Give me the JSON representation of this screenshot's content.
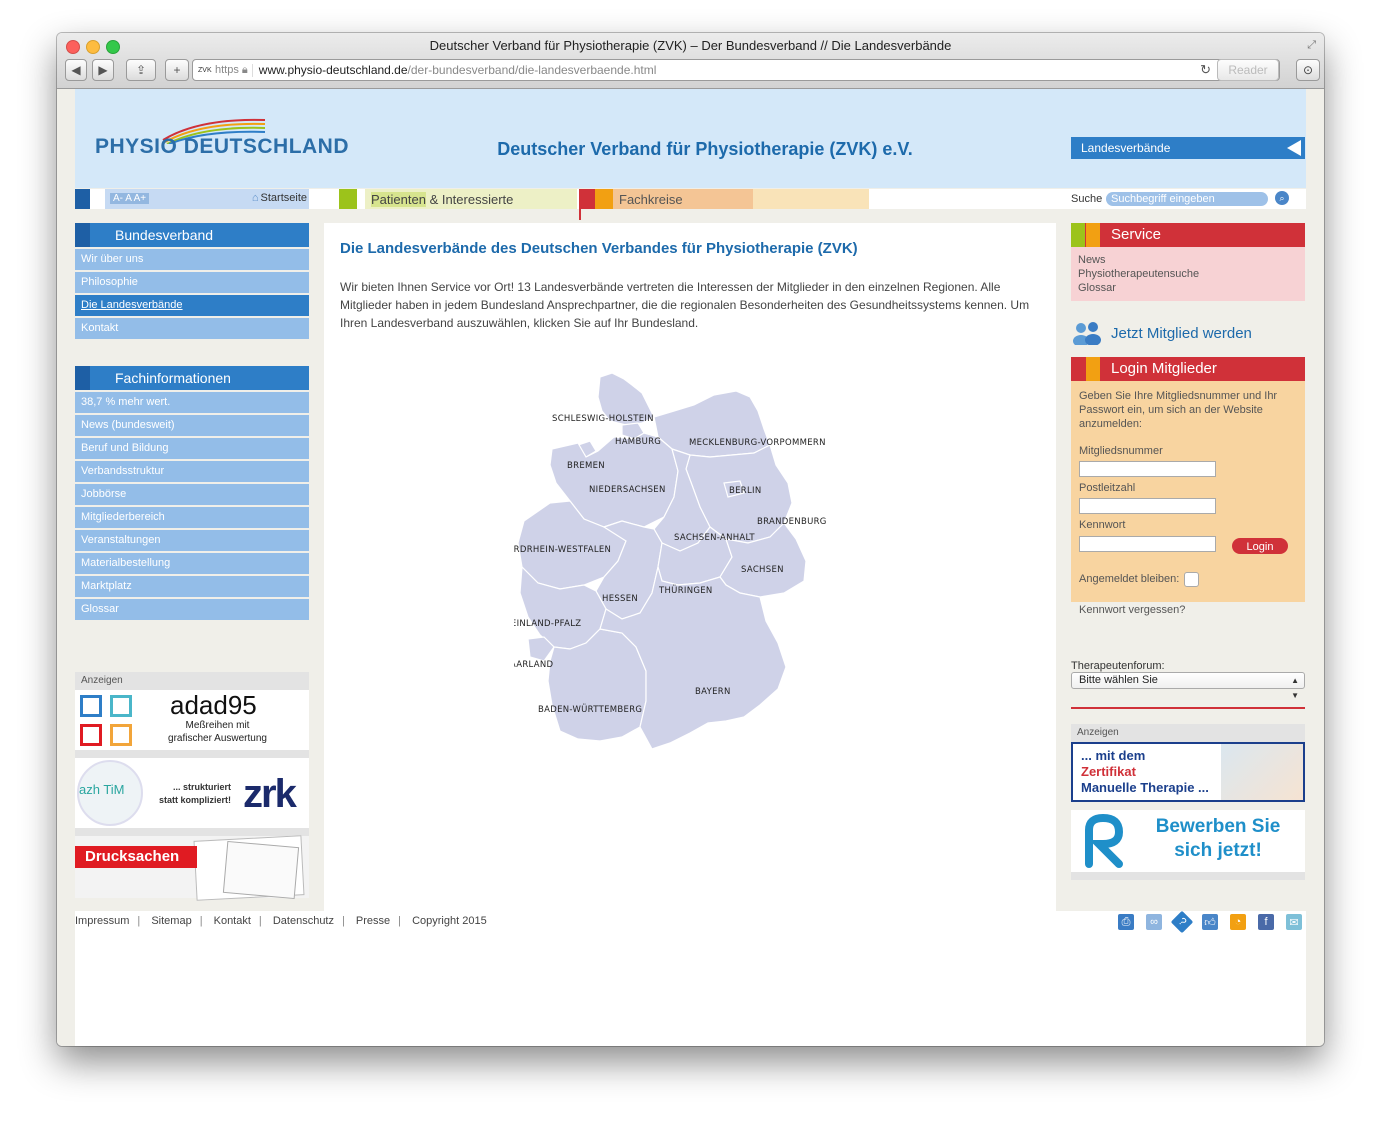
{
  "browser": {
    "title": "Deutscher Verband für Physiotherapie (ZVK) – Der Bundesverband // Die Landesverbände",
    "url_favicon": "ZVK",
    "url_scheme": "https",
    "url_host": "www.physio-deutschland.de",
    "url_path": "/der-bundesverband/die-landesverbaende.html",
    "reader_label": "Reader"
  },
  "header": {
    "logo_text": "PHYSIO DEUTSCHLAND",
    "site_title": "Deutscher Verband für Physiotherapie (ZVK) e.V.",
    "landesverbaende_label": "Landesverbände"
  },
  "topnav": {
    "font_sizes": "A- A A+",
    "home_label": "Startseite",
    "patienten_label": "Patienten",
    "patienten_rest": "& Interessierte",
    "fachkreise_label": "Fachkreise",
    "search_label": "Suche",
    "search_placeholder": "Suchbegriff eingeben"
  },
  "sidebar": {
    "bundesverband": {
      "title": "Bundesverband",
      "items": [
        "Wir über uns",
        "Philosophie",
        "Die Landesverbände",
        "Kontakt"
      ]
    },
    "fachinfo": {
      "title": "Fachinformationen",
      "items": [
        "38,7 % mehr wert.",
        "News (bundesweit)",
        "Beruf und Bildung",
        "Verbandsstruktur",
        "Jobbörse",
        "Mitgliederbereich",
        "Veranstaltungen",
        "Materialbestellung",
        "Marktplatz",
        "Glossar"
      ]
    },
    "ads": {
      "label": "Anzeigen",
      "adad_title": "adad95",
      "adad_sub1": "Meßreihen mit",
      "adad_sub2": "grafischer Auswertung",
      "azh_logo": "azh TiM",
      "azh_text1": "... strukturiert",
      "azh_text2": "statt kompliziert!",
      "zrk": "zrk",
      "drucksachen": "Drucksachen"
    }
  },
  "main": {
    "heading": "Die Landesverbände des Deutschen Verbandes für Physiotherapie (ZVK)",
    "intro": "Wir bieten Ihnen Service vor Ort! 13 Landesverbände vertreten die Interessen der Mitglieder in den einzelnen Regionen. Alle Mitglieder haben in jedem Bundesland Ansprechpartner, die die regionalen Besonderheiten des Gesundheitssystems kennen. Um Ihren Landesverband auszuwählen, klicken Sie auf Ihr Bundesland.",
    "map_states": [
      "SCHLESWIG-HOLSTEIN",
      "HAMBURG",
      "MECKLENBURG-VORPOMMERN",
      "BREMEN",
      "NIEDERSACHSEN",
      "BERLIN",
      "BRANDENBURG",
      "SACHSEN-ANHALT",
      "NORDRHEIN-WESTFALEN",
      "SACHSEN",
      "HESSEN",
      "THÜRINGEN",
      "RHEINLAND-PFALZ",
      "SAARLAND",
      "BAYERN",
      "BADEN-WÜRTTEMBERG"
    ],
    "map_color": "#cfd2e8"
  },
  "right": {
    "service": {
      "title": "Service",
      "items": [
        "News",
        "Physiotherapeutensuche",
        "Glossar"
      ]
    },
    "join_label": "Jetzt Mitglied werden",
    "login": {
      "title": "Login Mitglieder",
      "intro": "Geben Sie Ihre Mitgliedsnummer und Ihr Passwort ein, um sich an der Website anzumelden:",
      "field1": "Mitgliedsnummer",
      "field2": "Postleitzahl",
      "field3": "Kennwort",
      "button": "Login",
      "remember": "Angemeldet bleiben:",
      "forgot": "Kennwort vergessen?"
    },
    "forum_label": "Therapeutenforum:",
    "forum_select": "Bitte wählen Sie",
    "ads": {
      "label": "Anzeigen",
      "mt_line1": "... mit dem",
      "mt_line2": "Zertifikat",
      "mt_line3": "Manuelle Therapie ...",
      "bewerben1": "Bewerben Sie",
      "bewerben2": "sich jetzt!"
    }
  },
  "footer": {
    "links": [
      "Impressum",
      "Sitemap",
      "Kontakt",
      "Datenschutz",
      "Presse",
      "Copyright 2015"
    ],
    "icons": [
      "print-icon",
      "link-icon",
      "help-icon",
      "like-icon",
      "rss-icon",
      "facebook-icon",
      "email-icon"
    ]
  },
  "colors": {
    "brand_blue": "#2e7ec7",
    "dark_blue": "#1e5fa5",
    "light_blue": "#93bde8",
    "red": "#d03139",
    "green": "#9cc31b",
    "orange": "#f2a012"
  }
}
